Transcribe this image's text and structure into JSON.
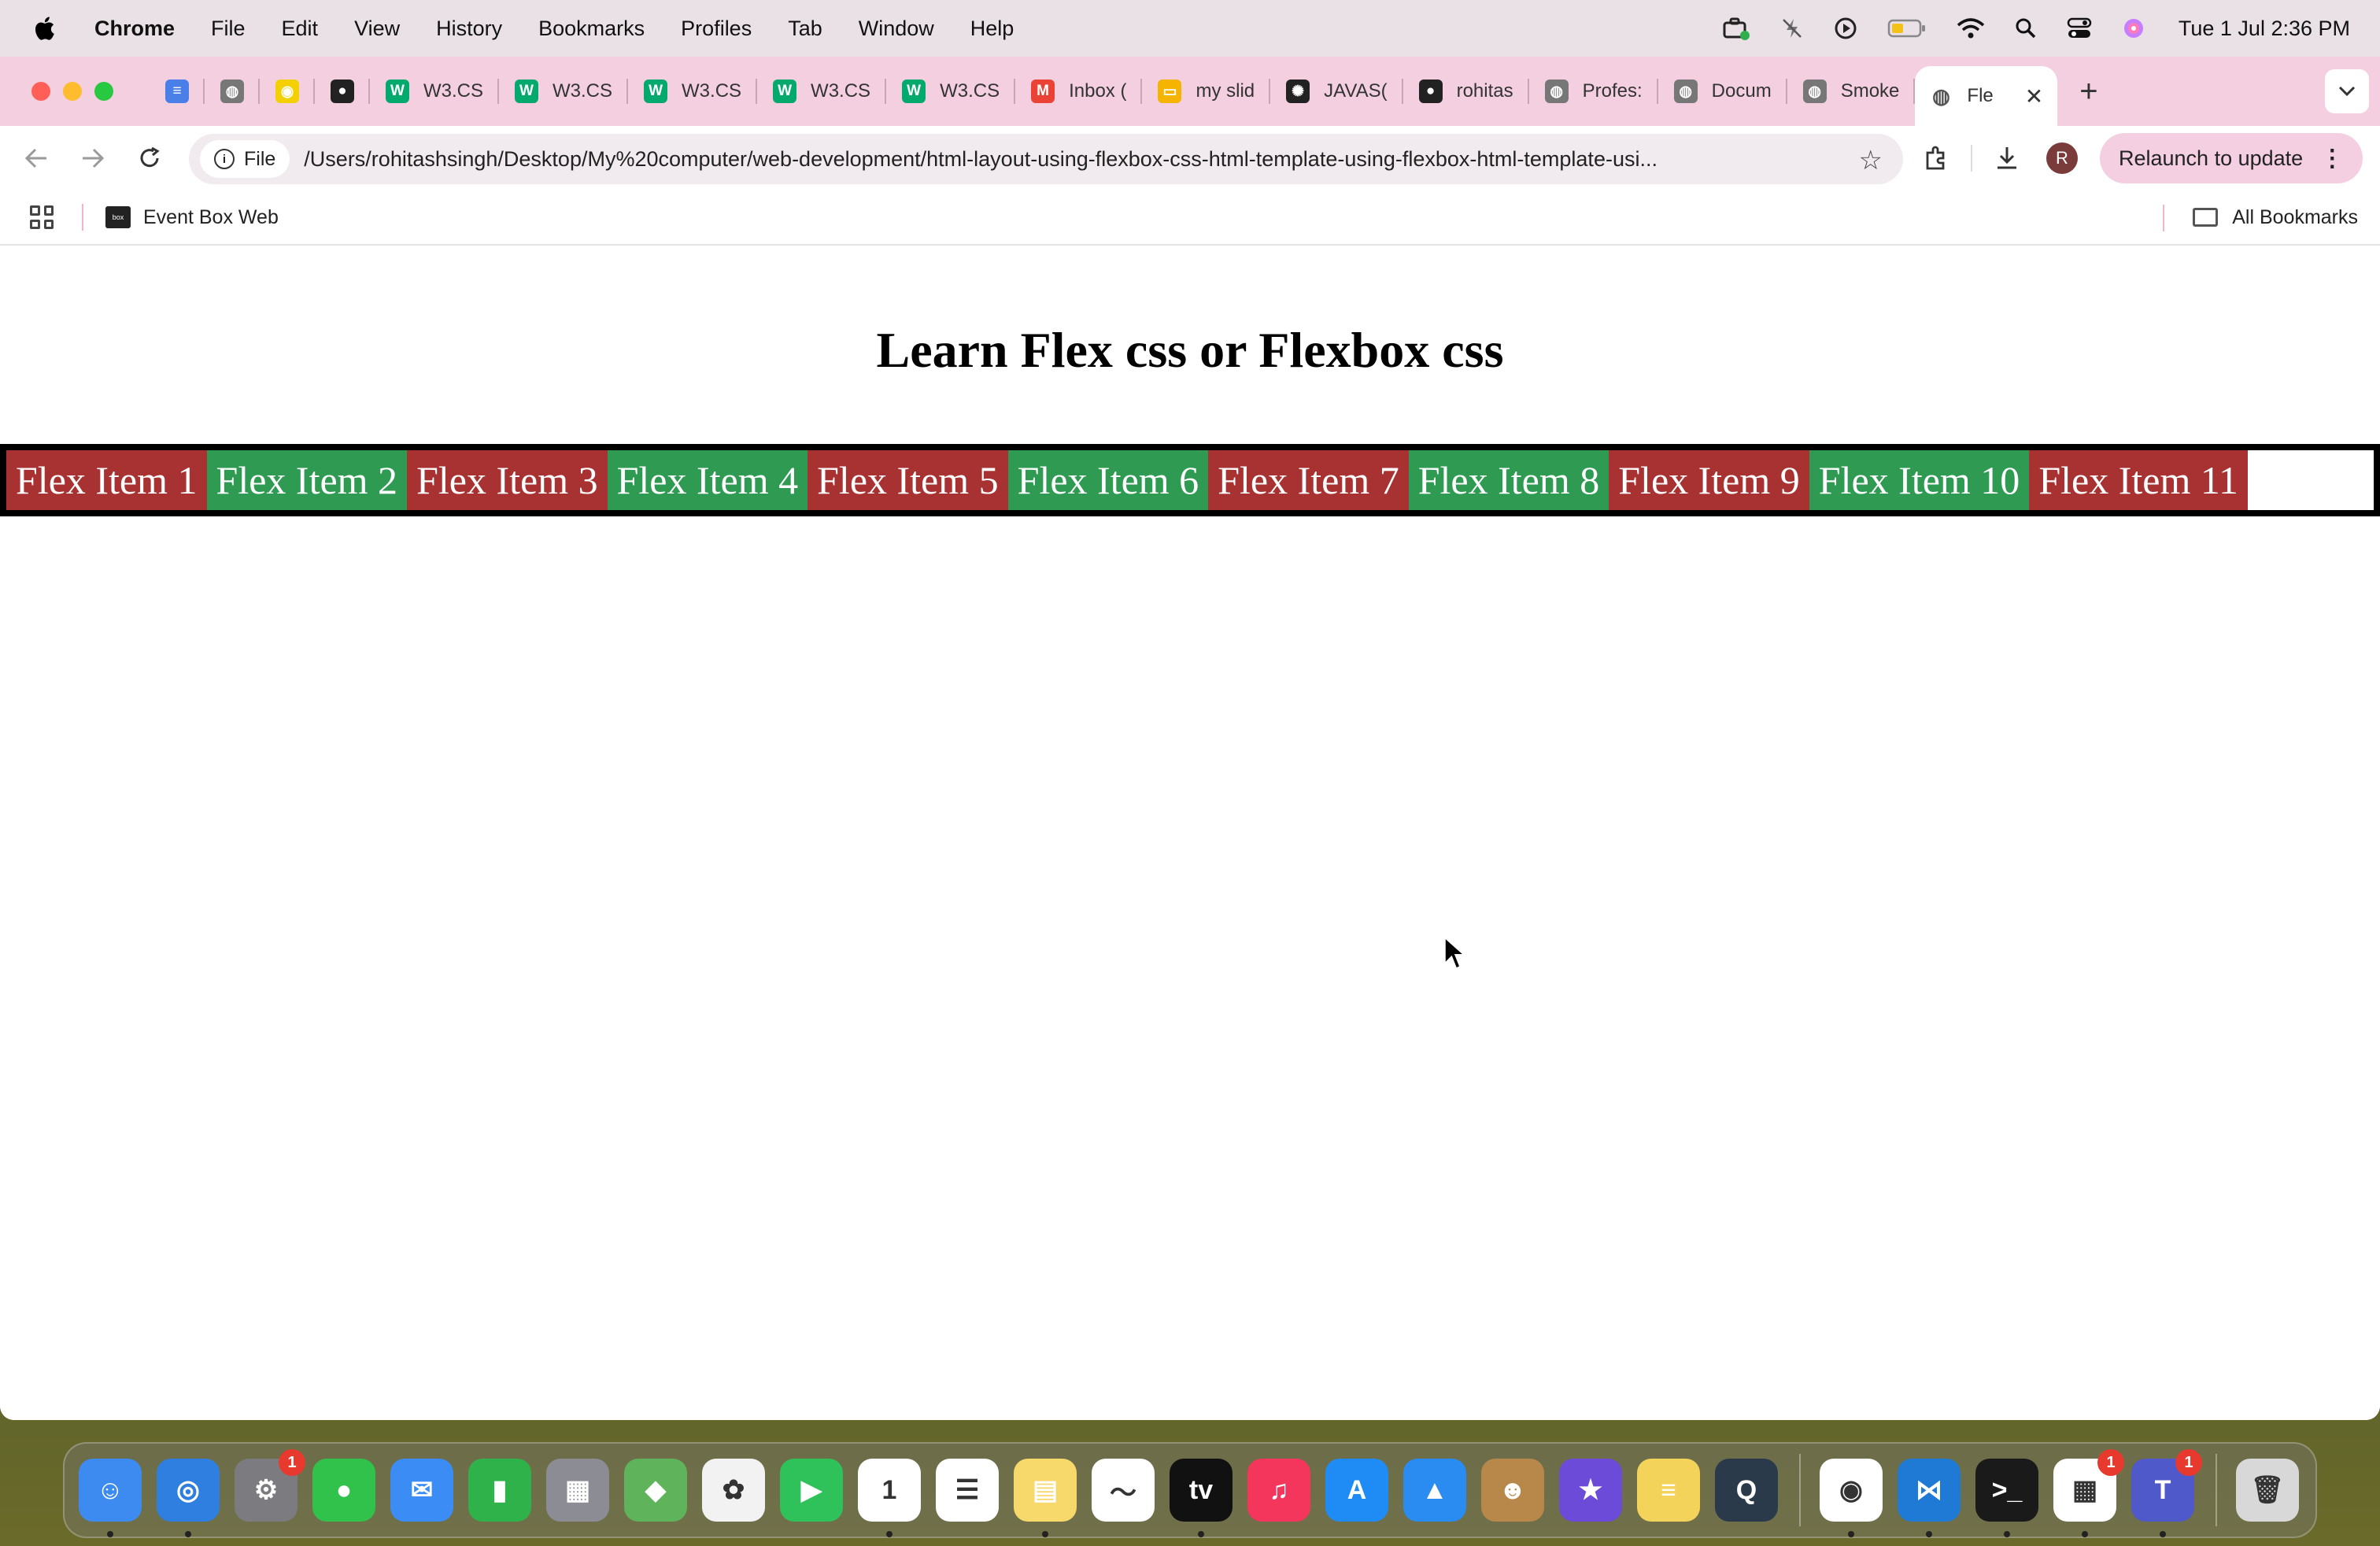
{
  "menubar": {
    "items": [
      "Chrome",
      "File",
      "Edit",
      "View",
      "History",
      "Bookmarks",
      "Profiles",
      "Tab",
      "Window",
      "Help"
    ],
    "clock": "Tue 1 Jul  2:36 PM"
  },
  "tabs": [
    {
      "label": "",
      "icon": "docs-icon",
      "color": "#4a7fe8"
    },
    {
      "label": "",
      "icon": "globe-icon",
      "color": "#777"
    },
    {
      "label": "",
      "icon": "eye-icon",
      "color": "#f5d000"
    },
    {
      "label": "",
      "icon": "github-icon",
      "color": "#222"
    },
    {
      "label": "W3.CS",
      "icon": "w3-icon",
      "color": "#04aa6d"
    },
    {
      "label": "W3.CS",
      "icon": "w3-icon",
      "color": "#04aa6d"
    },
    {
      "label": "W3.CS",
      "icon": "w3-icon",
      "color": "#04aa6d"
    },
    {
      "label": "W3.CS",
      "icon": "w3-icon",
      "color": "#04aa6d"
    },
    {
      "label": "W3.CS",
      "icon": "w3-icon",
      "color": "#04aa6d"
    },
    {
      "label": "Inbox (",
      "icon": "gmail-icon",
      "color": "#ea4335"
    },
    {
      "label": "my slid",
      "icon": "slides-icon",
      "color": "#f4b400"
    },
    {
      "label": "JAVAS(",
      "icon": "openai-icon",
      "color": "#222"
    },
    {
      "label": "rohitas",
      "icon": "github-icon",
      "color": "#222"
    },
    {
      "label": "Profes:",
      "icon": "globe-icon",
      "color": "#777"
    },
    {
      "label": "Docum",
      "icon": "globe-icon",
      "color": "#777"
    },
    {
      "label": "Smoke",
      "icon": "globe-icon",
      "color": "#777"
    }
  ],
  "active_tab": {
    "label": "Fle",
    "icon": "globe-icon"
  },
  "toolbar": {
    "chip_label": "File",
    "url": "/Users/rohitashsingh/Desktop/My%20computer/web-development/html-layout-using-flexbox-css-html-template-using-flexbox-html-template-usi...",
    "relaunch_label": "Relaunch to update",
    "avatar_letter": "R"
  },
  "bookmarks": {
    "item_label": "Event Box Web",
    "all_label": "All Bookmarks"
  },
  "page": {
    "heading": "Learn Flex css or Flexbox css",
    "flex_items": [
      {
        "label": "Flex Item 1",
        "color": "#a83232"
      },
      {
        "label": "Flex Item 2",
        "color": "#2f9a52"
      },
      {
        "label": "Flex Item 3",
        "color": "#a83232"
      },
      {
        "label": "Flex Item 4",
        "color": "#2f9a52"
      },
      {
        "label": "Flex Item 5",
        "color": "#a83232"
      },
      {
        "label": "Flex Item 6",
        "color": "#2f9a52"
      },
      {
        "label": "Flex Item 7",
        "color": "#a83232"
      },
      {
        "label": "Flex Item 8",
        "color": "#2f9a52"
      },
      {
        "label": "Flex Item 9",
        "color": "#a83232"
      },
      {
        "label": "Flex Item 10",
        "color": "#2f9a52"
      },
      {
        "label": "Flex Item 11",
        "color": "#a83232"
      }
    ]
  },
  "dock": {
    "apps": [
      {
        "name": "finder",
        "color": "#3d8bf0",
        "glyph": "☺",
        "badge": "",
        "running": true
      },
      {
        "name": "safari",
        "color": "#2f7fe0",
        "glyph": "◎",
        "badge": "",
        "running": true
      },
      {
        "name": "system-settings",
        "color": "#7c7c80",
        "glyph": "⚙",
        "badge": "1",
        "running": false
      },
      {
        "name": "messages",
        "color": "#30c24a",
        "glyph": "●",
        "badge": "",
        "running": false
      },
      {
        "name": "mail",
        "color": "#3b8cf5",
        "glyph": "✉",
        "badge": "",
        "running": false
      },
      {
        "name": "numbers",
        "color": "#2fb24a",
        "glyph": "▮",
        "badge": "",
        "running": false
      },
      {
        "name": "launchpad",
        "color": "#8c8c94",
        "glyph": "▦",
        "badge": "",
        "running": false
      },
      {
        "name": "maps",
        "color": "#5fb35a",
        "glyph": "◆",
        "badge": "",
        "running": false
      },
      {
        "name": "photos",
        "color": "#f2f2f2",
        "glyph": "✿",
        "badge": "",
        "running": false
      },
      {
        "name": "facetime",
        "color": "#2fc25a",
        "glyph": "▶",
        "badge": "",
        "running": false
      },
      {
        "name": "calendar",
        "color": "#ffffff",
        "glyph": "1",
        "badge": "",
        "running": true
      },
      {
        "name": "reminders",
        "color": "#ffffff",
        "glyph": "☰",
        "badge": "",
        "running": false
      },
      {
        "name": "notes",
        "color": "#f7d86a",
        "glyph": "▤",
        "badge": "",
        "running": true
      },
      {
        "name": "freeform",
        "color": "#ffffff",
        "glyph": "〜",
        "badge": "",
        "running": false
      },
      {
        "name": "apple-tv",
        "color": "#111111",
        "glyph": "tv",
        "badge": "",
        "running": true
      },
      {
        "name": "music",
        "color": "#f5365c",
        "glyph": "♫",
        "badge": "",
        "running": false
      },
      {
        "name": "app-store",
        "color": "#1f8cf5",
        "glyph": "A",
        "badge": "",
        "running": false
      },
      {
        "name": "keynote",
        "color": "#2a8cf0",
        "glyph": "▲",
        "badge": "",
        "running": false
      },
      {
        "name": "contacts",
        "color": "#b8874a",
        "glyph": "☻",
        "badge": "",
        "running": false
      },
      {
        "name": "imovie",
        "color": "#6b4bd8",
        "glyph": "★",
        "badge": "",
        "running": false
      },
      {
        "name": "stickies",
        "color": "#f3d35a",
        "glyph": "≡",
        "badge": "",
        "running": false
      },
      {
        "name": "quicktime",
        "color": "#2a3a4a",
        "glyph": "Q",
        "badge": "",
        "running": false
      }
    ],
    "apps_right": [
      {
        "name": "chrome",
        "color": "#ffffff",
        "glyph": "◉",
        "badge": "",
        "running": true
      },
      {
        "name": "vscode",
        "color": "#1f7ad6",
        "glyph": "⋈",
        "badge": "",
        "running": true
      },
      {
        "name": "terminal",
        "color": "#1a1a1a",
        "glyph": ">_",
        "badge": "",
        "running": true
      },
      {
        "name": "microsoft-store",
        "color": "#ffffff",
        "glyph": "▦",
        "badge": "1",
        "running": true
      },
      {
        "name": "teams",
        "color": "#5059c9",
        "glyph": "T",
        "badge": "1",
        "running": true
      }
    ],
    "trash": {
      "name": "trash",
      "color": "#d8d8d8",
      "glyph": "🗑"
    }
  }
}
